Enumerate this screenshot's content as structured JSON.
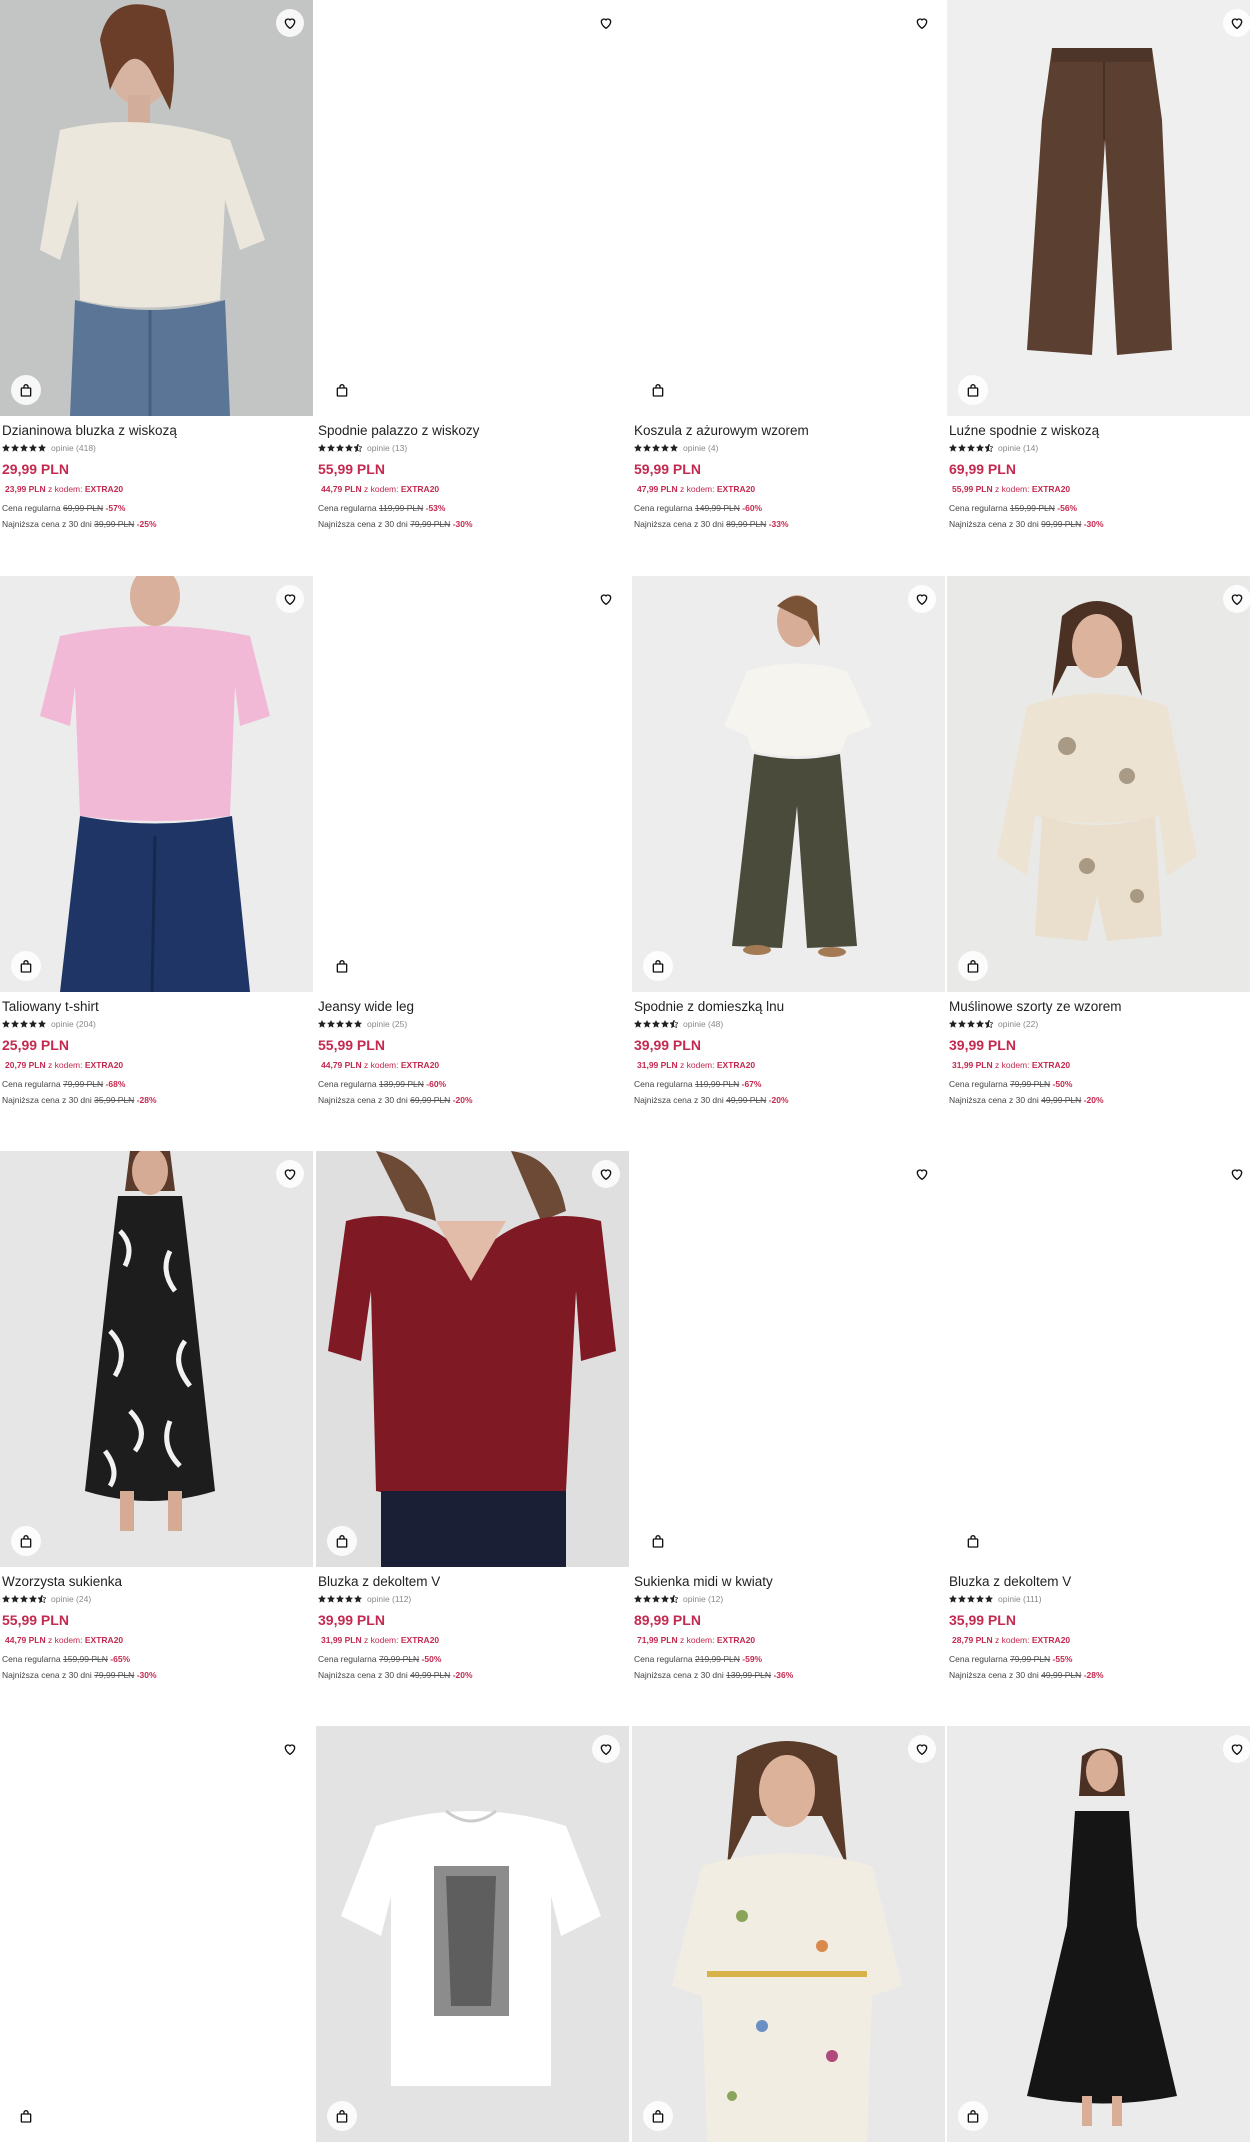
{
  "colors": {
    "accent": "#c4294f",
    "text": "#222222",
    "muted": "#888888",
    "image_bg": "#e9e9e9"
  },
  "icons": {
    "favorite": "heart-outline-icon",
    "quick_add": "shopping-bag-icon",
    "rating": "star-icon"
  },
  "labels": {
    "reviews_prefix": "opinie",
    "code_text": "z kodem:",
    "regular_price": "Cena regularna",
    "lowest_price": "Najniższa cena z 30 dni"
  },
  "products": [
    {
      "name": "Dzianinowa bluzka z wiskozą",
      "rating": 5,
      "reviews": "opinie (418)",
      "price": "29,99 PLN",
      "promo_price": "23,99 PLN",
      "promo_code": "EXTRA20",
      "regular_price": "69,99 PLN",
      "regular_discount": "-57%",
      "lowest_price": "39,99 PLN",
      "lowest_discount": "-25%"
    },
    {
      "name": "Spodnie palazzo z wiskozy",
      "rating": 4.5,
      "reviews": "opinie (13)",
      "price": "55,99 PLN",
      "promo_price": "44,79 PLN",
      "promo_code": "EXTRA20",
      "regular_price": "119,99 PLN",
      "regular_discount": "-53%",
      "lowest_price": "79,99 PLN",
      "lowest_discount": "-30%"
    },
    {
      "name": "Koszula z ażurowym wzorem",
      "rating": 5,
      "reviews": "opinie (4)",
      "price": "59,99 PLN",
      "promo_price": "47,99 PLN",
      "promo_code": "EXTRA20",
      "regular_price": "149,99 PLN",
      "regular_discount": "-60%",
      "lowest_price": "89,99 PLN",
      "lowest_discount": "-33%"
    },
    {
      "name": "Luźne spodnie z wiskozą",
      "rating": 4.5,
      "reviews": "opinie (14)",
      "price": "69,99 PLN",
      "promo_price": "55,99 PLN",
      "promo_code": "EXTRA20",
      "regular_price": "159,99 PLN",
      "regular_discount": "-56%",
      "lowest_price": "99,99 PLN",
      "lowest_discount": "-30%"
    },
    {
      "name": "Taliowany t-shirt",
      "rating": 5,
      "reviews": "opinie (204)",
      "price": "25,99 PLN",
      "promo_price": "20,79 PLN",
      "promo_code": "EXTRA20",
      "regular_price": "79,99 PLN",
      "regular_discount": "-68%",
      "lowest_price": "35,99 PLN",
      "lowest_discount": "-28%"
    },
    {
      "name": "Jeansy wide leg",
      "rating": 5,
      "reviews": "opinie (25)",
      "price": "55,99 PLN",
      "promo_price": "44,79 PLN",
      "promo_code": "EXTRA20",
      "regular_price": "139,99 PLN",
      "regular_discount": "-60%",
      "lowest_price": "69,99 PLN",
      "lowest_discount": "-20%"
    },
    {
      "name": "Spodnie z domieszką lnu",
      "rating": 4.5,
      "reviews": "opinie (48)",
      "price": "39,99 PLN",
      "promo_price": "31,99 PLN",
      "promo_code": "EXTRA20",
      "regular_price": "119,99 PLN",
      "regular_discount": "-67%",
      "lowest_price": "49,99 PLN",
      "lowest_discount": "-20%"
    },
    {
      "name": "Muślinowe szorty ze wzorem",
      "rating": 4.5,
      "reviews": "opinie (22)",
      "price": "39,99 PLN",
      "promo_price": "31,99 PLN",
      "promo_code": "EXTRA20",
      "regular_price": "79,99 PLN",
      "regular_discount": "-50%",
      "lowest_price": "49,99 PLN",
      "lowest_discount": "-20%"
    },
    {
      "name": "Wzorzysta sukienka",
      "rating": 4.5,
      "reviews": "opinie (24)",
      "price": "55,99 PLN",
      "promo_price": "44,79 PLN",
      "promo_code": "EXTRA20",
      "regular_price": "159,99 PLN",
      "regular_discount": "-65%",
      "lowest_price": "79,99 PLN",
      "lowest_discount": "-30%"
    },
    {
      "name": "Bluzka z dekoltem V",
      "rating": 5,
      "reviews": "opinie (112)",
      "price": "39,99 PLN",
      "promo_price": "31,99 PLN",
      "promo_code": "EXTRA20",
      "regular_price": "79,99 PLN",
      "regular_discount": "-50%",
      "lowest_price": "49,99 PLN",
      "lowest_discount": "-20%"
    },
    {
      "name": "Sukienka midi w kwiaty",
      "rating": 4.5,
      "reviews": "opinie (12)",
      "price": "89,99 PLN",
      "promo_price": "71,99 PLN",
      "promo_code": "EXTRA20",
      "regular_price": "219,99 PLN",
      "regular_discount": "-59%",
      "lowest_price": "139,99 PLN",
      "lowest_discount": "-36%"
    },
    {
      "name": "Bluzka z dekoltem V",
      "rating": 5,
      "reviews": "opinie (111)",
      "price": "35,99 PLN",
      "promo_price": "28,79 PLN",
      "promo_code": "EXTRA20",
      "regular_price": "79,99 PLN",
      "regular_discount": "-55%",
      "lowest_price": "49,99 PLN",
      "lowest_discount": "-28%"
    },
    {},
    {},
    {},
    {}
  ]
}
